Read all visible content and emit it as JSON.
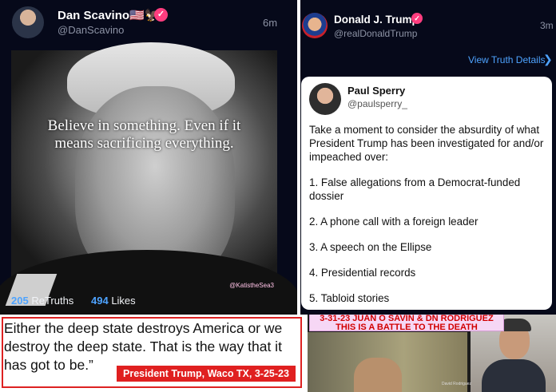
{
  "left_post": {
    "name": "Dan Scavino🇺🇸🦅",
    "handle": "@DanScavino",
    "time": "6m",
    "image_quote_line1": "Believe in something. Even if it",
    "image_quote_line2": "means sacrificing everything.",
    "watermark": "@KatistheSea3",
    "retruths_count": "205",
    "retruths_label": "ReTruths",
    "likes_count": "494",
    "likes_label": "Likes"
  },
  "right_post": {
    "name": "Donald J. Trump",
    "handle": "@realDonaldTrump",
    "time": "3m",
    "view_link": "View Truth Details",
    "card": {
      "name": "Paul Sperry",
      "handle": "@paulsperry_",
      "intro": "Take a moment to consider the absurdity of what President Trump has been investigated for and/or impeached over:",
      "items": [
        "1. False allegations from a Democrat-funded dossier",
        "2. A phone call with a foreign leader",
        "3. A speech on the Ellipse",
        "4. Presidential records",
        "5. Tabloid stories"
      ]
    }
  },
  "quote_box": {
    "text": "Either the deep state destroys America or we destroy the deep state. That is the way that it has got to be.”",
    "attribution": "President Trump, Waco TX, 3-25-23"
  },
  "video": {
    "banner_line1": "3-31-23 JUAN O SAVIN & DN RODRIGUEZ",
    "banner_line2": "THIS IS A BATTLE TO THE DEATH",
    "caption": "David Rodriguez"
  },
  "colors": {
    "background": "#06091a",
    "accent_blue": "#4ea3ff",
    "verified_pink": "#ff3d7f",
    "red": "#e02020"
  }
}
